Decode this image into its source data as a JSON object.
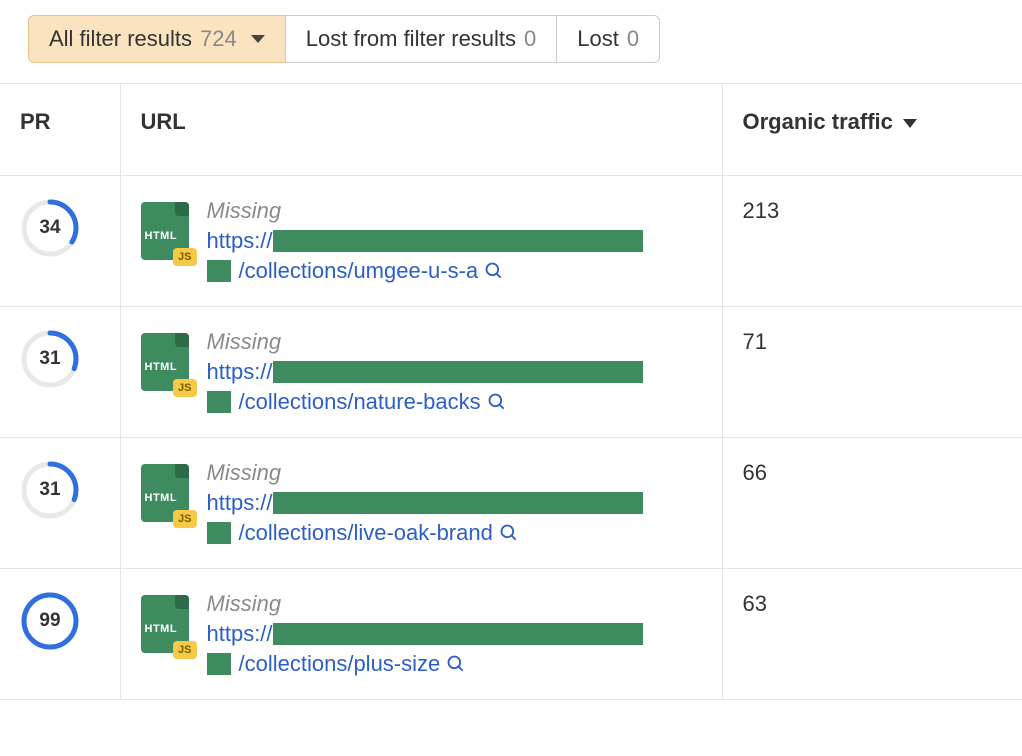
{
  "tabs": [
    {
      "label": "All filter results",
      "count": "724",
      "active": true,
      "hasCaret": true
    },
    {
      "label": "Lost from filter results",
      "count": "0",
      "active": false,
      "hasCaret": false
    },
    {
      "label": "Lost",
      "count": "0",
      "active": false,
      "hasCaret": false
    }
  ],
  "columns": {
    "pr": "PR",
    "url": "URL",
    "traffic": "Organic traffic"
  },
  "rows": [
    {
      "pr": "34",
      "prPct": 34,
      "status": "Missing",
      "proto": "https://",
      "path": "/collections/umgee-u-s-a",
      "traffic": "213"
    },
    {
      "pr": "31",
      "prPct": 31,
      "status": "Missing",
      "proto": "https://",
      "path": "/collections/nature-backs",
      "traffic": "71"
    },
    {
      "pr": "31",
      "prPct": 31,
      "status": "Missing",
      "proto": "https://",
      "path": "/collections/live-oak-brand",
      "traffic": "66"
    },
    {
      "pr": "99",
      "prPct": 99,
      "status": "Missing",
      "proto": "https://",
      "path": "/collections/plus-size",
      "traffic": "63"
    }
  ],
  "fileIcon": {
    "label": "HTML",
    "badge": "JS"
  }
}
